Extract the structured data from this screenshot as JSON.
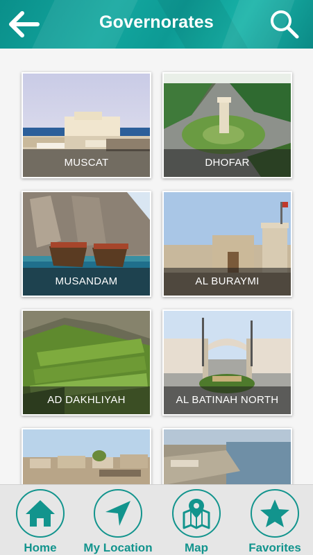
{
  "header": {
    "title": "Governorates",
    "back_icon": "arrow-left-icon",
    "search_icon": "search-icon"
  },
  "governorates": [
    {
      "name": "MUSCAT"
    },
    {
      "name": "DHOFAR"
    },
    {
      "name": "MUSANDAM"
    },
    {
      "name": "AL BURAYMI"
    },
    {
      "name": "AD DAKHLIYAH"
    },
    {
      "name": "AL BATINAH NORTH"
    },
    {
      "name": ""
    },
    {
      "name": ""
    }
  ],
  "bottom_nav": {
    "items": [
      {
        "label": "Home",
        "icon": "home-icon"
      },
      {
        "label": "My Location",
        "icon": "location-arrow-icon"
      },
      {
        "label": "Map",
        "icon": "map-icon"
      },
      {
        "label": "Favorites",
        "icon": "star-icon"
      }
    ]
  },
  "colors": {
    "accent": "#12948d",
    "header": "#0f9c95",
    "nav_bg": "#e6e6e6"
  }
}
